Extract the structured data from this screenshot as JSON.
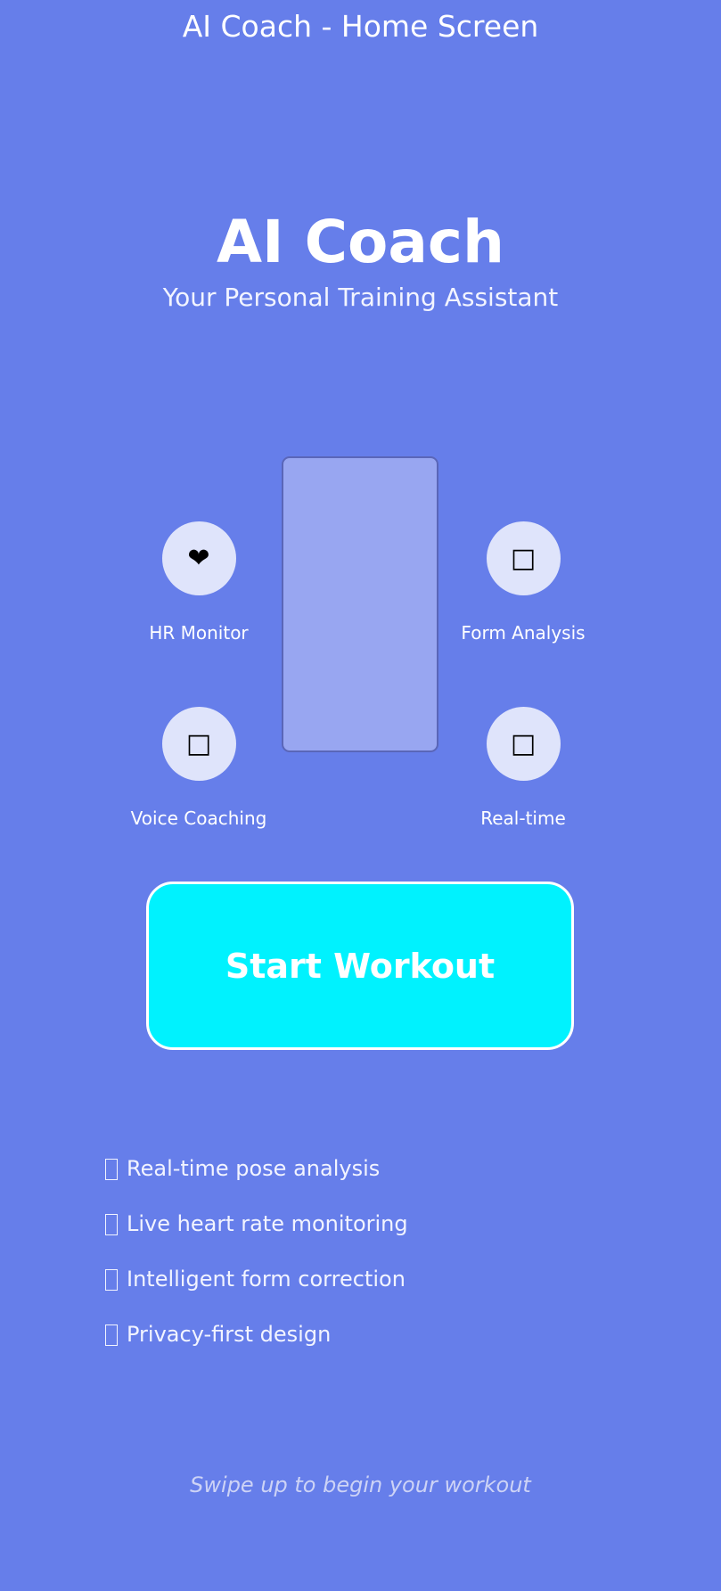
{
  "header": {
    "screen_title": "AI Coach - Home Screen"
  },
  "hero": {
    "app_name": "AI Coach",
    "tagline": "Your Personal Training Assistant"
  },
  "features": [
    {
      "icon": "heart-icon",
      "glyph": "❤",
      "label": "HR Monitor"
    },
    {
      "icon": "form-analysis-icon",
      "glyph": "□",
      "label": "Form Analysis"
    },
    {
      "icon": "voice-icon",
      "glyph": "□",
      "label": "Voice Coaching"
    },
    {
      "icon": "realtime-icon",
      "glyph": "□",
      "label": "Real-time"
    }
  ],
  "cta": {
    "start_label": "Start Workout",
    "color": "#00f2fe"
  },
  "benefits": [
    "Real-time pose analysis",
    "Live heart rate monitoring",
    "Intelligent form correction",
    "Privacy-first design"
  ],
  "footer": {
    "hint": "Swipe up to begin your workout"
  },
  "colors": {
    "background": "#667eea",
    "phone_frame": "#98a6f1",
    "icon_circle": "#dfe4fb"
  }
}
